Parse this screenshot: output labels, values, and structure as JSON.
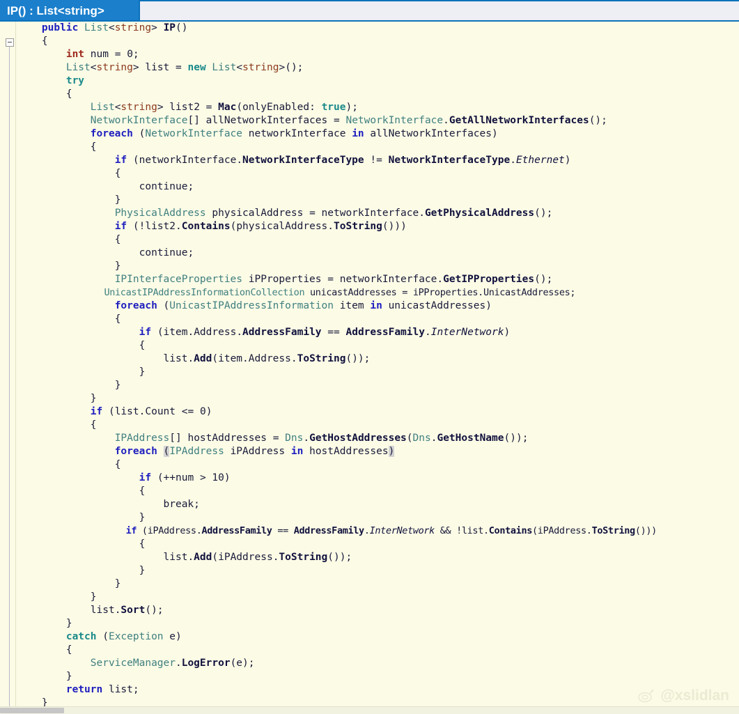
{
  "window": {
    "tab_label": "IP() : List<string>",
    "accent_color": "#1b7fcc",
    "tabstrip_color": "#0b72ba",
    "background_color": "#fbfbe6"
  },
  "watermark": {
    "handle": "@xslidlan",
    "logo": "weibo-eye-icon"
  },
  "editor": {
    "language": "csharp",
    "folding": {
      "state": "expanded",
      "glyph": "minus"
    },
    "brace_match_highlight": true
  },
  "colors": {
    "keyword": "#1f1fbf",
    "keyword_control": "#1b8a8a",
    "type": "#3f7f7f",
    "value_type": "#8c3a1e",
    "primitive": "#9e2a1e",
    "method": "#11113d",
    "text": "#1a1a3a",
    "brace_highlight": "#d2d2d2"
  },
  "code": {
    "lines": [
      "    public List<string> IP()",
      "    {",
      "        int num = 0;",
      "        List<string> list = new List<string>();",
      "        try",
      "        {",
      "            List<string> list2 = Mac(onlyEnabled: true);",
      "            NetworkInterface[] allNetworkInterfaces = NetworkInterface.GetAllNetworkInterfaces();",
      "            foreach (NetworkInterface networkInterface in allNetworkInterfaces)",
      "            {",
      "                if (networkInterface.NetworkInterfaceType != NetworkInterfaceType.Ethernet)",
      "                {",
      "                    continue;",
      "                }",
      "                PhysicalAddress physicalAddress = networkInterface.GetPhysicalAddress();",
      "                if (!list2.Contains(physicalAddress.ToString()))",
      "                {",
      "                    continue;",
      "                }",
      "                IPInterfaceProperties iPProperties = networkInterface.GetIPProperties();",
      "                UnicastIPAddressInformationCollection unicastAddresses = iPProperties.UnicastAddresses;",
      "                foreach (UnicastIPAddressInformation item in unicastAddresses)",
      "                {",
      "                    if (item.Address.AddressFamily == AddressFamily.InterNetwork)",
      "                    {",
      "                        list.Add(item.Address.ToString());",
      "                    }",
      "                }",
      "            }",
      "            if (list.Count <= 0)",
      "            {",
      "                IPAddress[] hostAddresses = Dns.GetHostAddresses(Dns.GetHostName());",
      "                foreach (IPAddress iPAddress in hostAddresses)",
      "                {",
      "                    if (++num > 10)",
      "                    {",
      "                        break;",
      "                    }",
      "                    if (iPAddress.AddressFamily == AddressFamily.InterNetwork && !list.Contains(iPAddress.ToString()))",
      "                    {",
      "                        list.Add(iPAddress.ToString());",
      "                    }",
      "                }",
      "            }",
      "            list.Sort();",
      "        }",
      "        catch (Exception e)",
      "        {",
      "            ServiceManager.LogError(e);",
      "        }",
      "        return list;",
      "    }"
    ]
  }
}
